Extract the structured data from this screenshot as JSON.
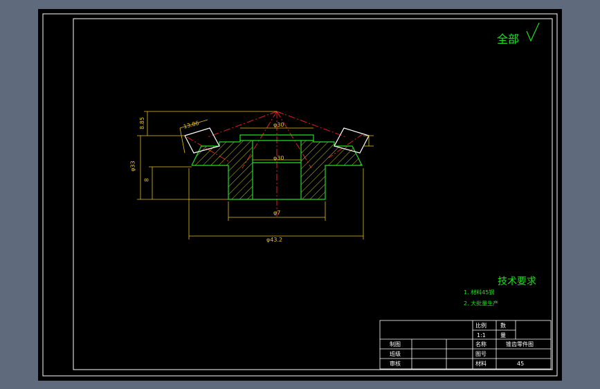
{
  "finish_note": {
    "label": "全部",
    "symbol": "√"
  },
  "dimensions": {
    "bottom_outer": "φ43.2",
    "bore_top": "φ30",
    "bore": "φ30",
    "hub_bottom": "φ7",
    "left_overall": "φ33",
    "left_lower": "8",
    "left_top": "8.85",
    "tooth_angle": "13.86"
  },
  "tech_requirements": {
    "title": "技术要求",
    "items": [
      "1. 材料45钢",
      "2. 大批量生产"
    ]
  },
  "title_block": {
    "scale_label": "比例",
    "scale_value": "1:1",
    "quantity_label": "数",
    "quantity_value": "量",
    "drawn_by": "制图",
    "class": "班级",
    "checked_by": "审核",
    "name_label": "名称",
    "name_value": "锥齿零件图",
    "drawing_no_label": "图号",
    "material_label": "材料",
    "material_value": "45"
  },
  "colors": {
    "background": "#5f6b7d",
    "paper": "#000000",
    "border": "#ffffff",
    "outline": "#22dd22",
    "dimension": "#e8c020",
    "centerline": "#e02020",
    "hatch": "#c8c820"
  }
}
